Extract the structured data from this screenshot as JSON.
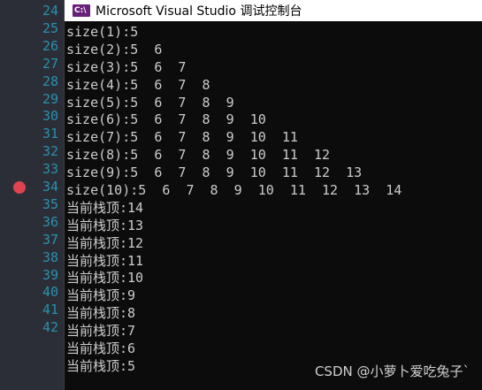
{
  "editor": {
    "line_numbers": [
      "24",
      "25",
      "26",
      "27",
      "28",
      "29",
      "30",
      "31",
      "32",
      "33",
      "34",
      "35",
      "36",
      "37",
      "38",
      "39",
      "40",
      "41",
      "42"
    ]
  },
  "console": {
    "title": "Microsoft Visual Studio 调试控制台",
    "icon": "vs-console-icon",
    "icon_glyph": "C:\\",
    "lines": [
      "size(1):5",
      "size(2):5  6",
      "size(3):5  6  7",
      "size(4):5  6  7  8",
      "size(5):5  6  7  8  9",
      "size(6):5  6  7  8  9  10",
      "size(7):5  6  7  8  9  10  11",
      "size(8):5  6  7  8  9  10  11  12",
      "size(9):5  6  7  8  9  10  11  12  13",
      "size(10):5  6  7  8  9  10  11  12  13  14",
      "当前栈顶:14",
      "当前栈顶:13",
      "当前栈顶:12",
      "当前栈顶:11",
      "当前栈顶:10",
      "当前栈顶:9",
      "当前栈顶:8",
      "当前栈顶:7",
      "当前栈顶:6",
      "当前栈顶:5"
    ]
  },
  "watermark": "CSDN @小萝卜爱吃兔子`",
  "colors": {
    "console_bg": "#0c0c0c",
    "console_text": "#cccccc",
    "line_number": "#2b91af",
    "breakpoint": "#e0424f",
    "vs_purple": "#68217a"
  }
}
